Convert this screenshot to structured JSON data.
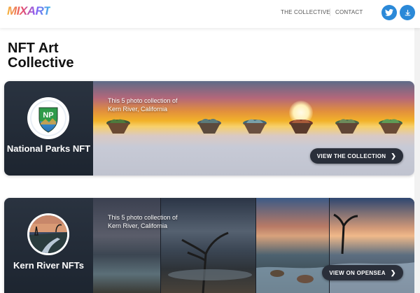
{
  "header": {
    "logo_text": "MIXART",
    "nav": [
      "THE COLLECTIVE",
      "CONTACT"
    ],
    "icons": [
      "twitter-icon",
      "download-icon"
    ]
  },
  "page_title": "NFT Art Collective",
  "cards": [
    {
      "title": "National Parks NFT",
      "badge_text": "NP",
      "description": "This 5 photo collection of Kern River, California",
      "button_label": "VIEW THE COLLECTION"
    },
    {
      "title": "Kern River NFTs",
      "description": "This 5 photo collection of Kern River, California",
      "button_label": "VIEW ON OPENSEA"
    }
  ],
  "colors": {
    "accent_blue": "#2b89d8",
    "card_dark": "#1f2732",
    "button_dark": "#2a2f3a"
  }
}
